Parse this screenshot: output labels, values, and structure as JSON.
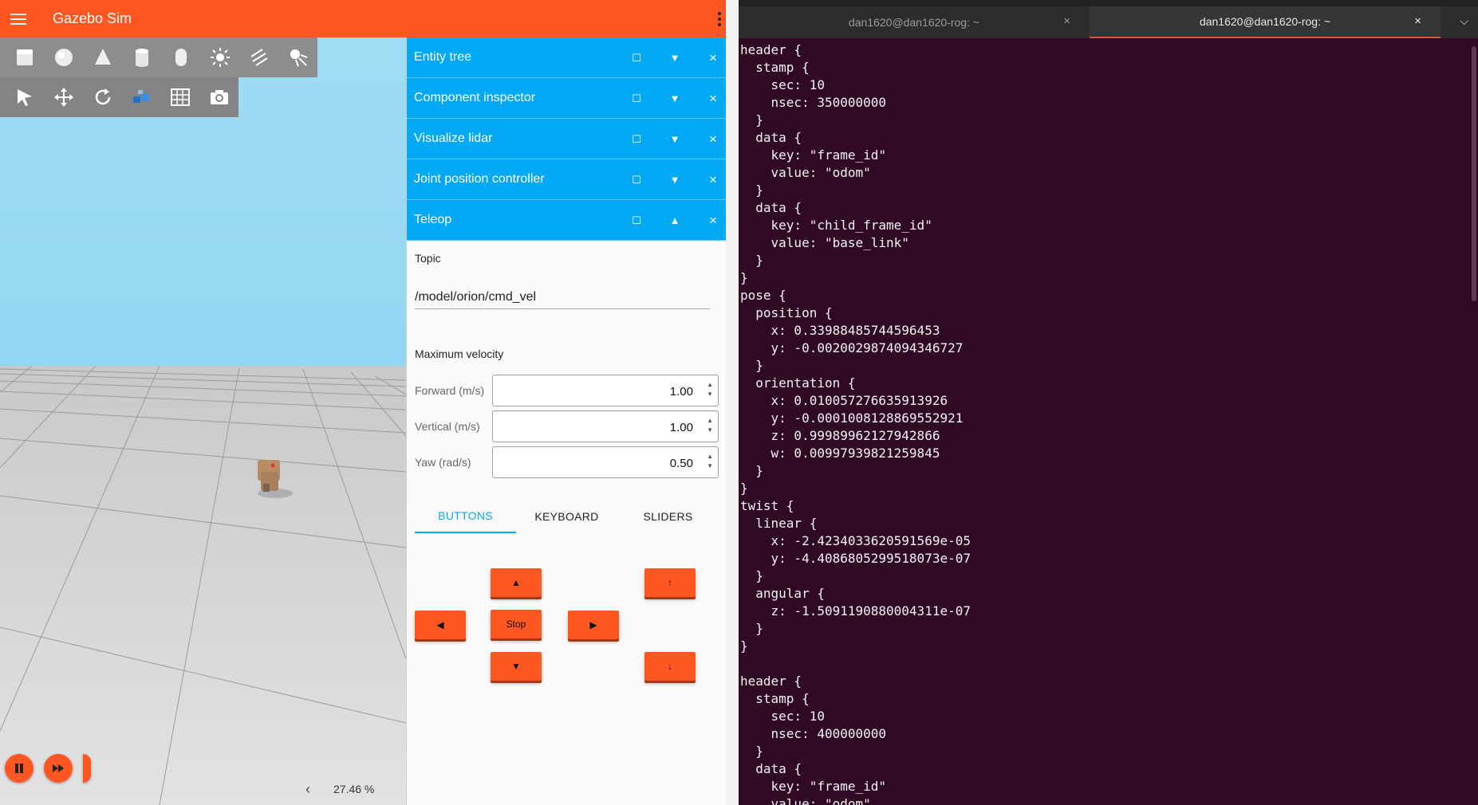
{
  "app": {
    "title": "Gazebo Sim",
    "zoom": "27.46 %"
  },
  "toolbar_shapes": [
    "box-icon",
    "sphere-icon",
    "cone-icon",
    "cylinder-icon",
    "capsule-icon",
    "sun-light-icon",
    "directional-light-icon",
    "spot-light-icon"
  ],
  "toolbar_tools": [
    "select-icon",
    "translate-icon",
    "rotate-icon",
    "align-icon",
    "grid-icon",
    "screenshot-icon"
  ],
  "panels": [
    {
      "title": "Entity tree",
      "collapse_glyph": "▼"
    },
    {
      "title": "Component inspector",
      "collapse_glyph": "▼"
    },
    {
      "title": "Visualize lidar",
      "collapse_glyph": "▼"
    },
    {
      "title": "Joint position controller",
      "collapse_glyph": "▼"
    },
    {
      "title": "Teleop",
      "collapse_glyph": "▲"
    }
  ],
  "teleop": {
    "topic_label": "Topic",
    "topic_value": "/model/orion/cmd_vel",
    "max_velocity_label": "Maximum velocity",
    "forward_label": "Forward (m/s)",
    "forward_value": "1.00",
    "vertical_label": "Vertical (m/s)",
    "vertical_value": "1.00",
    "yaw_label": "Yaw (rad/s)",
    "yaw_value": "0.50",
    "tabs": [
      "BUTTONS",
      "KEYBOARD",
      "SLIDERS"
    ],
    "buttons": {
      "forward": "▲",
      "backward": "▼",
      "left": "◀",
      "right": "▶",
      "stop": "Stop",
      "up": "↑",
      "down": "↓"
    }
  },
  "terminal": {
    "tab1": "dan1620@dan1620-rog: ~",
    "tab2": "dan1620@dan1620-rog: ~",
    "text": "  ~~~~~~~~~~~~~~~~~~~~~~~~~~~~~~~~~~~~~~~~~~~~~~~~~\nheader {\n  stamp {\n    sec: 10\n    nsec: 350000000\n  }\n  data {\n    key: \"frame_id\"\n    value: \"odom\"\n  }\n  data {\n    key: \"child_frame_id\"\n    value: \"base_link\"\n  }\n}\npose {\n  position {\n    x: 0.33988485744596453\n    y: -0.0020029874094346727\n  }\n  orientation {\n    x: 0.010057276635913926\n    y: -0.0001008128869552921\n    z: 0.99989962127942866\n    w: 0.00997939821259845\n  }\n}\ntwist {\n  linear {\n    x: -2.4234033620591569e-05\n    y: -4.4086805299518073e-07\n  }\n  angular {\n    z: -1.5091190880004311e-07\n  }\n}\n\nheader {\n  stamp {\n    sec: 10\n    nsec: 400000000\n  }\n  data {\n    key: \"frame_id\"\n    value: \"odom\""
  },
  "colors": {
    "gazebo_accent": "#ff5722",
    "panel_header": "#03a9f4",
    "terminal_bg": "#300a24",
    "terminal_tab_accent": "#e95420"
  }
}
